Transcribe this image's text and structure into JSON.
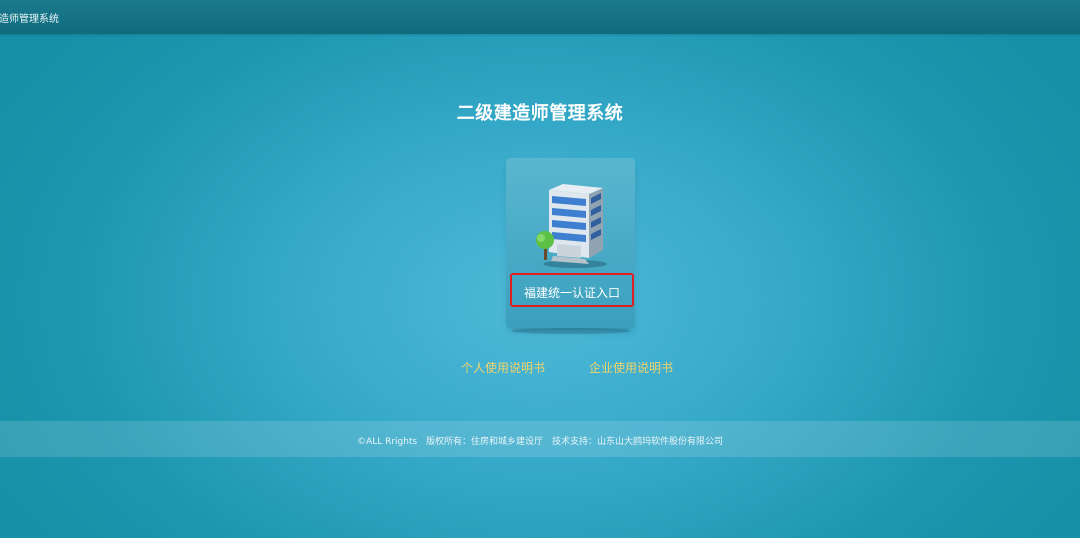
{
  "window": {
    "title": "造师管理系统"
  },
  "page": {
    "title": "二级建造师管理系统"
  },
  "entry": {
    "icon": "building-icon",
    "label": "福建统一认证入口"
  },
  "manuals": {
    "personal": "个人使用说明书",
    "enterprise": "企业使用说明书"
  },
  "footer": {
    "copyright": "©ALL Rrights",
    "owner": "版权所有：住房和城乡建设厅",
    "support": "技术支持：山东山大鸥玛软件股份有限公司"
  },
  "colors": {
    "background": "#36a9c9",
    "topbar": "#126f80",
    "link": "#f3d36a",
    "highlight_border": "#e02020"
  }
}
